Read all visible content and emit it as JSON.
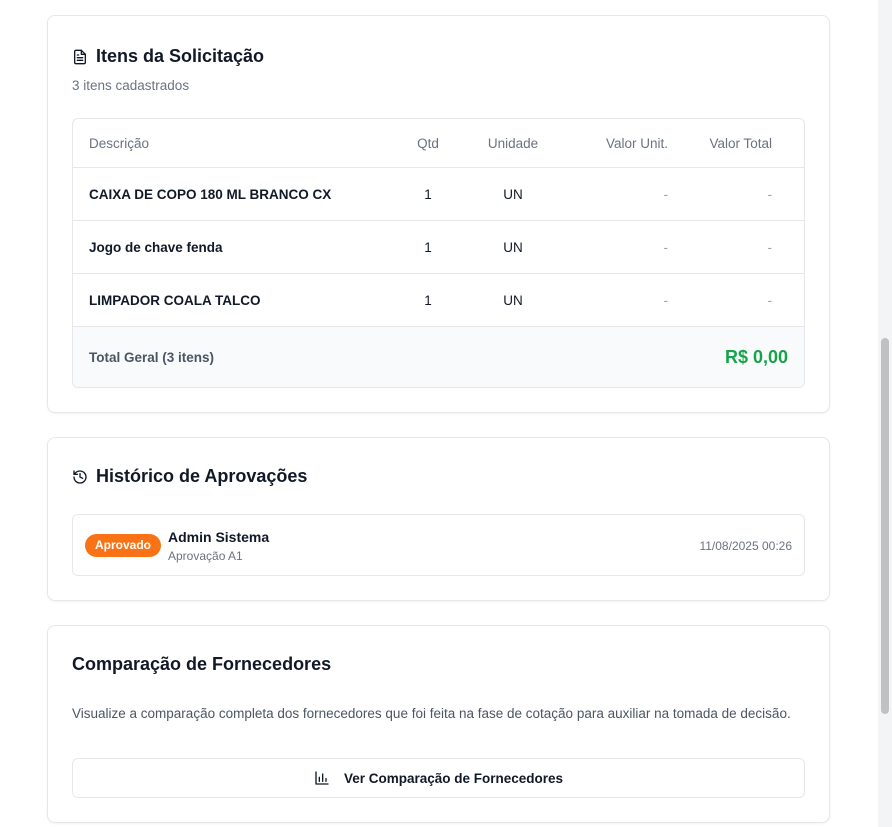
{
  "items_card": {
    "title": "Itens da Solicitação",
    "icon": "file-text-icon",
    "subtitle": "3 itens cadastrados",
    "headers": {
      "descricao": "Descrição",
      "qtd": "Qtd",
      "unidade": "Unidade",
      "valor_unit": "Valor Unit.",
      "valor_total": "Valor Total"
    },
    "rows": [
      {
        "descricao": "CAIXA DE COPO 180 ML BRANCO CX",
        "qtd": "1",
        "unidade": "UN",
        "valor_unit": "-",
        "valor_total": "-"
      },
      {
        "descricao": "Jogo de chave fenda",
        "qtd": "1",
        "unidade": "UN",
        "valor_unit": "-",
        "valor_total": "-"
      },
      {
        "descricao": "LIMPADOR COALA TALCO",
        "qtd": "1",
        "unidade": "UN",
        "valor_unit": "-",
        "valor_total": "-"
      }
    ],
    "footer": {
      "label": "Total Geral (3 itens)",
      "total": "R$ 0,00"
    }
  },
  "history_card": {
    "title": "Histórico de Aprovações",
    "icon": "history-icon",
    "entries": [
      {
        "status": "Aprovado",
        "user": "Admin Sistema",
        "stage": "Aprovação A1",
        "date": "11/08/2025 00:26"
      }
    ]
  },
  "comparison_card": {
    "title": "Comparação de Fornecedores",
    "description": "Visualize a comparação completa dos fornecedores que foi feita na fase de cotação para auxiliar na tomada de decisão.",
    "button_label": "Ver Comparação de Fornecedores",
    "button_icon": "bar-chart-icon"
  },
  "colors": {
    "status_approved": "#f97316",
    "total_green": "#16a34a"
  }
}
